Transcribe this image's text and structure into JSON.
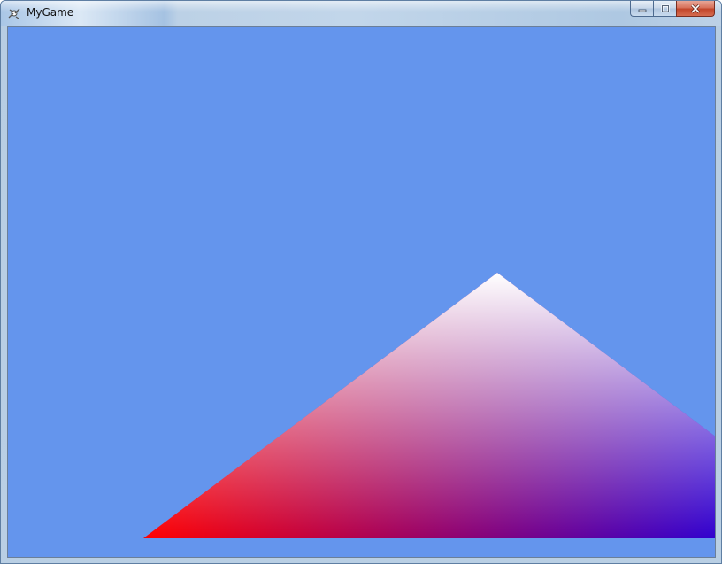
{
  "window": {
    "title": "MyGame",
    "app_icon": "app-icon"
  },
  "caption_buttons": {
    "minimize_icon": "minimize-icon",
    "maximize_icon": "maximize-icon",
    "close_icon": "close-icon"
  },
  "scene": {
    "clear_color": "#6495ED",
    "triangle": {
      "vertex_colors": {
        "top": "#FFFFFF",
        "bottom_left": "#FF0000",
        "bottom_right": "#0000FF"
      }
    }
  }
}
